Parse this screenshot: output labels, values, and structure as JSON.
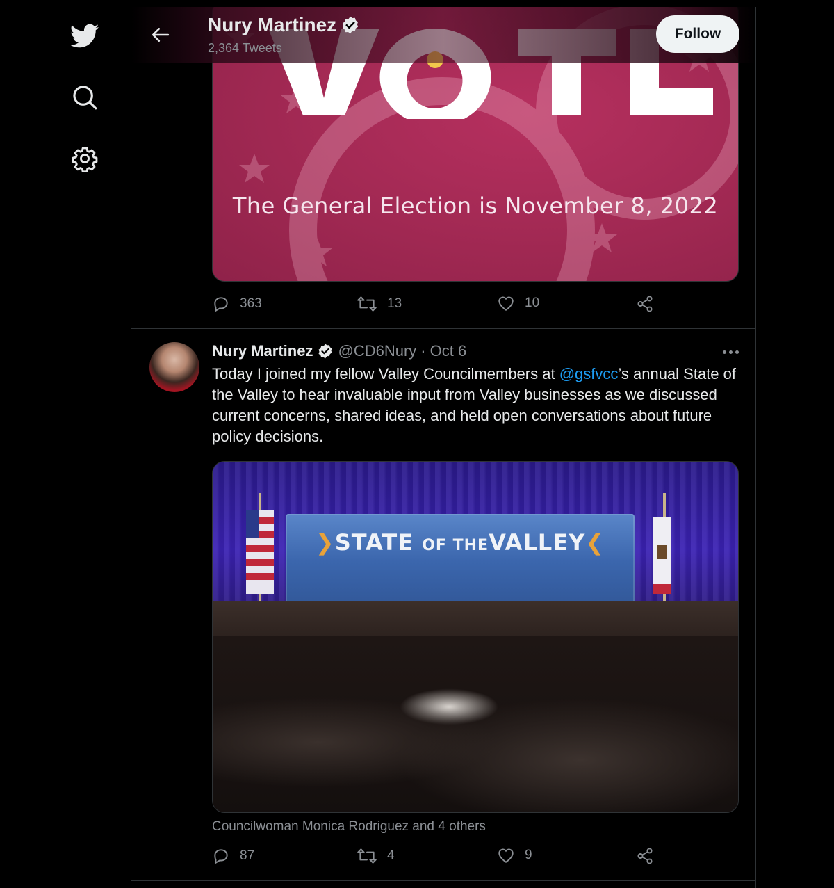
{
  "header": {
    "name": "Nury Martinez",
    "tweet_count": "2,364 Tweets",
    "follow_label": "Follow"
  },
  "tweet1": {
    "media_text": "The General Election is November 8, 2022",
    "media_big_word": "VOTE",
    "replies": "363",
    "retweets": "13",
    "likes": "10"
  },
  "tweet2": {
    "name": "Nury Martinez",
    "handle": "@CD6Nury",
    "separator": "·",
    "date": "Oct 6",
    "text_before": "Today I joined my fellow Valley Councilmembers at ",
    "mention": "@gsfvcc",
    "text_after": "’s annual State of the Valley to hear invaluable input from Valley businesses as we discussed current concerns, shared ideas, and held open conversations about future policy decisions.",
    "banner_left": "STATE",
    "banner_mid": "OF THE",
    "banner_right": "VALLEY",
    "tagged": "Councilwoman Monica Rodriguez and 4 others",
    "replies": "87",
    "retweets": "4",
    "likes": "9"
  },
  "icons": {
    "brand": "twitter-bird-icon",
    "search": "search-icon",
    "settings": "gear-icon",
    "back": "back-arrow-icon",
    "verified": "verified-badge-icon"
  },
  "colors": {
    "accent": "#1d9bf0",
    "background": "#000000",
    "text_secondary": "#8b8f94",
    "vote_pink": "#a52a55"
  }
}
